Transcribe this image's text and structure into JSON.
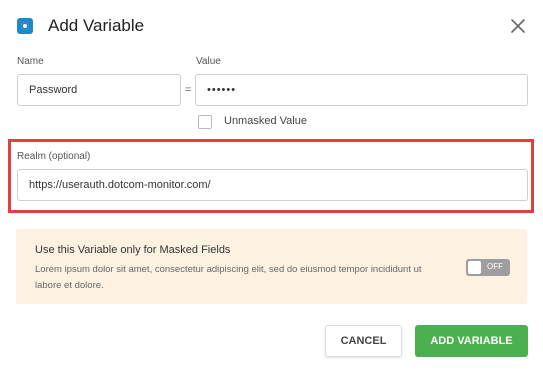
{
  "dialog": {
    "title": "Add Variable",
    "icon": "variable-icon",
    "close_icon": "close-icon"
  },
  "name_field": {
    "label": "Name",
    "value": "Password"
  },
  "separator": "=",
  "value_field": {
    "label": "Value",
    "value": "••••••"
  },
  "unmasked": {
    "label": "Unmasked Value",
    "checked": false
  },
  "realm_field": {
    "label": "Realm (optional)",
    "value": "https://userauth.dotcom-monitor.com/"
  },
  "masked_banner": {
    "title": "Use this Variable only for Masked Fields",
    "description": "Lorem ipsum dolor sit amet, consectetur adipiscing elit, sed do eiusmod tempor incididunt ut labore et dolore.",
    "toggle_label": "OFF",
    "toggle_on": false
  },
  "buttons": {
    "cancel": "CANCEL",
    "add": "ADD VARIABLE"
  },
  "colors": {
    "accent": "#1e88c9",
    "highlight_outline": "#e0403f",
    "banner_background": "#fdf2e2",
    "primary_button": "#4caf50"
  }
}
